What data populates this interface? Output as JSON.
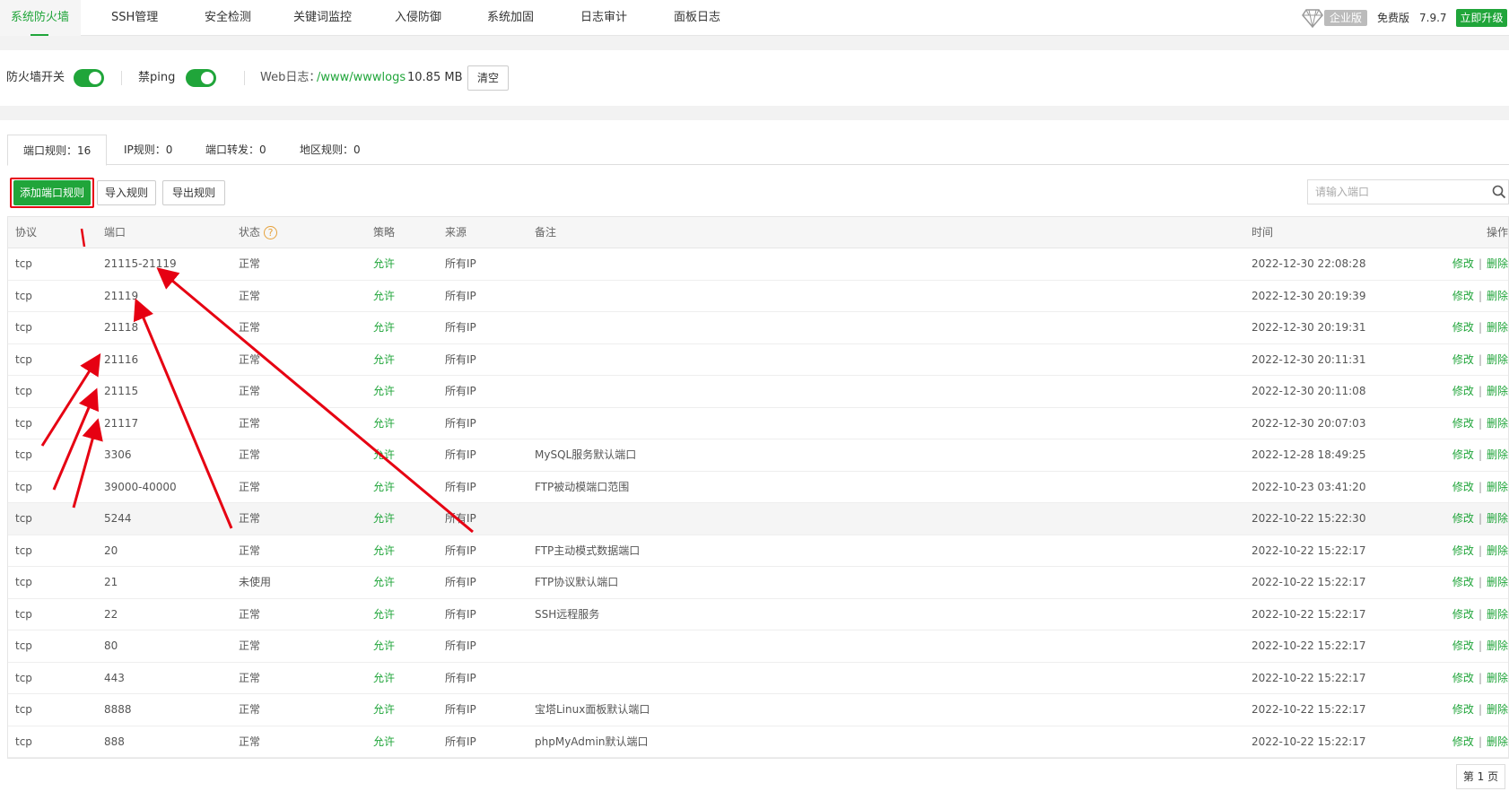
{
  "nav": {
    "tabs": [
      {
        "label": "系统防火墙",
        "active": true
      },
      {
        "label": "SSH管理"
      },
      {
        "label": "安全检测"
      },
      {
        "label": "关键词监控"
      },
      {
        "label": "入侵防御"
      },
      {
        "label": "系统加固"
      },
      {
        "label": "日志审计"
      },
      {
        "label": "面板日志"
      }
    ],
    "enterprise_badge": "企业版",
    "free_label": "免费版",
    "version": "7.9.7",
    "upgrade_label": "立即升级"
  },
  "controls": {
    "firewall_label": "防火墙开关",
    "firewall_on": true,
    "ping_label": "禁ping",
    "ping_on": true,
    "weblog_label": "Web日志：",
    "weblog_path": "/www/wwwlogs",
    "weblog_size": "10.85 MB",
    "clear_label": "清空"
  },
  "subtabs": [
    {
      "label": "端口规则：16",
      "active": true
    },
    {
      "label": "IP规则：0"
    },
    {
      "label": "端口转发：0"
    },
    {
      "label": "地区规则：0"
    }
  ],
  "toolbar": {
    "add_label": "添加端口规则",
    "import_label": "导入规则",
    "export_label": "导出规则",
    "search_placeholder": "请输入端口"
  },
  "table": {
    "headers": [
      "协议",
      "端口",
      "状态",
      "策略",
      "来源",
      "备注",
      "时间",
      "操作"
    ],
    "status_help": "?",
    "edit_label": "修改",
    "delete_label": "删除",
    "rows": [
      {
        "protocol": "tcp",
        "port": "21115-21119",
        "status": "正常",
        "policy": "允许",
        "source": "所有IP",
        "note": "",
        "time": "2022-12-30 22:08:28"
      },
      {
        "protocol": "tcp",
        "port": "21119",
        "status": "正常",
        "policy": "允许",
        "source": "所有IP",
        "note": "",
        "time": "2022-12-30 20:19:39"
      },
      {
        "protocol": "tcp",
        "port": "21118",
        "status": "正常",
        "policy": "允许",
        "source": "所有IP",
        "note": "",
        "time": "2022-12-30 20:19:31"
      },
      {
        "protocol": "tcp",
        "port": "21116",
        "status": "正常",
        "policy": "允许",
        "source": "所有IP",
        "note": "",
        "time": "2022-12-30 20:11:31"
      },
      {
        "protocol": "tcp",
        "port": "21115",
        "status": "正常",
        "policy": "允许",
        "source": "所有IP",
        "note": "",
        "time": "2022-12-30 20:11:08"
      },
      {
        "protocol": "tcp",
        "port": "21117",
        "status": "正常",
        "policy": "允许",
        "source": "所有IP",
        "note": "",
        "time": "2022-12-30 20:07:03"
      },
      {
        "protocol": "tcp",
        "port": "3306",
        "status": "正常",
        "policy": "允许",
        "source": "所有IP",
        "note": "MySQL服务默认端口",
        "time": "2022-12-28 18:49:25"
      },
      {
        "protocol": "tcp",
        "port": "39000-40000",
        "status": "正常",
        "policy": "允许",
        "source": "所有IP",
        "note": "FTP被动模端口范围",
        "time": "2022-10-23 03:41:20"
      },
      {
        "protocol": "tcp",
        "port": "5244",
        "status": "正常",
        "policy": "允许",
        "source": "所有IP",
        "note": "",
        "time": "2022-10-22 15:22:30",
        "highlight": true
      },
      {
        "protocol": "tcp",
        "port": "20",
        "status": "正常",
        "policy": "允许",
        "source": "所有IP",
        "note": "FTP主动模式数据端口",
        "time": "2022-10-22 15:22:17"
      },
      {
        "protocol": "tcp",
        "port": "21",
        "status": "未使用",
        "policy": "允许",
        "source": "所有IP",
        "note": "FTP协议默认端口",
        "time": "2022-10-22 15:22:17"
      },
      {
        "protocol": "tcp",
        "port": "22",
        "status": "正常",
        "policy": "允许",
        "source": "所有IP",
        "note": "SSH远程服务",
        "time": "2022-10-22 15:22:17"
      },
      {
        "protocol": "tcp",
        "port": "80",
        "status": "正常",
        "policy": "允许",
        "source": "所有IP",
        "note": "",
        "time": "2022-10-22 15:22:17"
      },
      {
        "protocol": "tcp",
        "port": "443",
        "status": "正常",
        "policy": "允许",
        "source": "所有IP",
        "note": "",
        "time": "2022-10-22 15:22:17"
      },
      {
        "protocol": "tcp",
        "port": "8888",
        "status": "正常",
        "policy": "允许",
        "source": "所有IP",
        "note": "宝塔Linux面板默认端口",
        "time": "2022-10-22 15:22:17"
      },
      {
        "protocol": "tcp",
        "port": "888",
        "status": "正常",
        "policy": "允许",
        "source": "所有IP",
        "note": "phpMyAdmin默认端口",
        "time": "2022-10-22 15:22:17"
      }
    ]
  },
  "pager": {
    "page_label": "第 1 页"
  },
  "colors": {
    "accent": "#20a53a",
    "annotation": "#e60012",
    "help": "#e6a23c"
  }
}
